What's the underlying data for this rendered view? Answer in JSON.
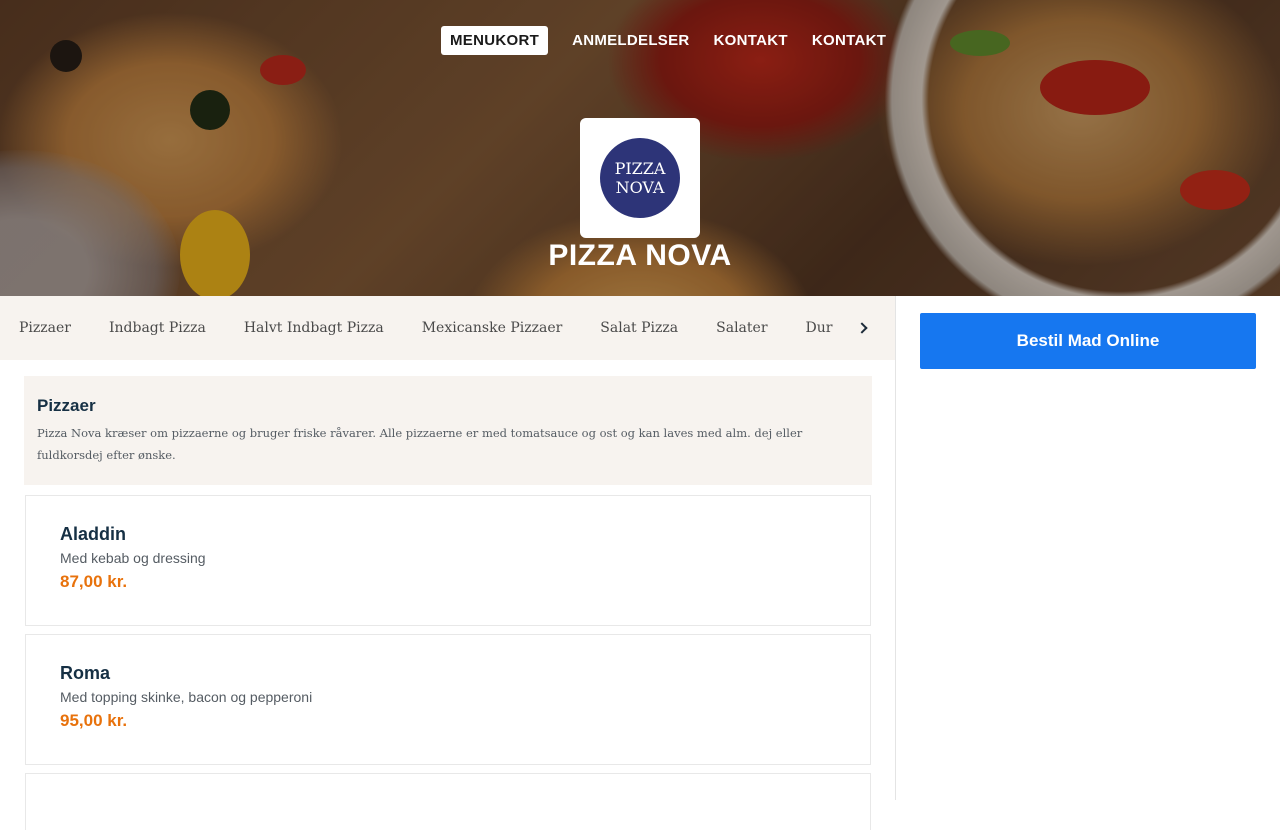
{
  "nav": {
    "items": [
      {
        "label": "MENUKORT",
        "active": true
      },
      {
        "label": "ANMELDELSER",
        "active": false
      },
      {
        "label": "KONTAKT",
        "active": false
      },
      {
        "label": "KONTAKT",
        "active": false
      }
    ]
  },
  "brand": {
    "logo_line1": "PIZZA",
    "logo_line2": "NOVA",
    "name": "PIZZA NOVA",
    "logo_color": "#2d3478"
  },
  "categories": {
    "items": [
      "Pizzaer",
      "Indbagt Pizza",
      "Halvt Indbagt Pizza",
      "Mexicanske Pizzaer",
      "Salat Pizza",
      "Salater",
      "Durum"
    ],
    "next_icon": "chevron-right-icon"
  },
  "section": {
    "title": "Pizzaer",
    "description": "Pizza Nova kræser om pizzaerne og bruger friske råvarer. Alle pizzaerne er med tomatsauce og ost og kan laves med alm. dej eller fuldkorsdej efter ønske."
  },
  "menu_items": [
    {
      "name": "Aladdin",
      "description": "Med kebab og dressing",
      "price": "87,00 kr."
    },
    {
      "name": "Roma",
      "description": "Med topping skinke, bacon og pepperoni",
      "price": "95,00 kr."
    }
  ],
  "sidebar": {
    "order_button": "Bestil Mad Online"
  },
  "colors": {
    "accent": "#1677f0",
    "price": "#e8720c",
    "heading": "#163044",
    "bar_bg": "#f7f3ef"
  }
}
